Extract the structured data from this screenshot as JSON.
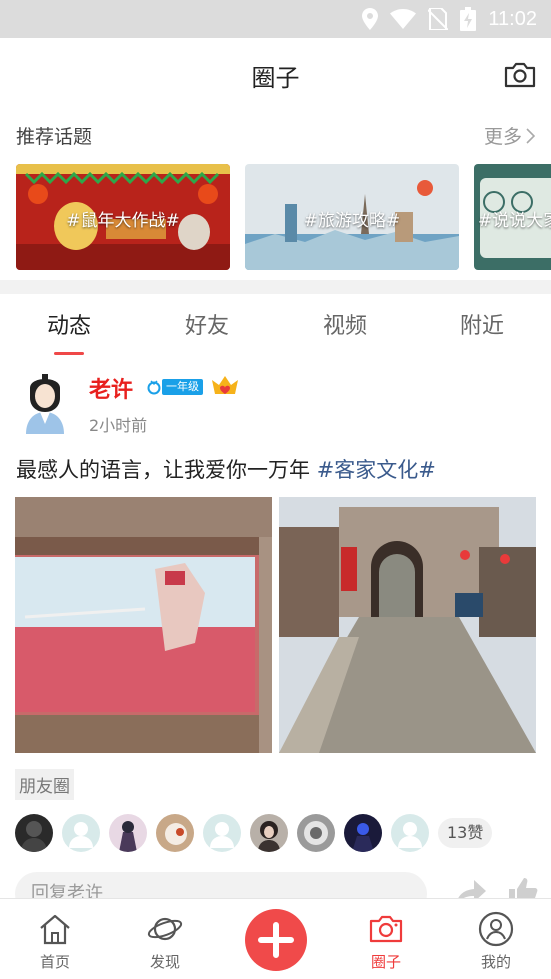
{
  "status_bar": {
    "time": "11:02"
  },
  "header": {
    "title": "圈子"
  },
  "recommend": {
    "title": "推荐话题",
    "more_label": "更多",
    "topics": [
      {
        "label": "#鼠年大作战#"
      },
      {
        "label": "#旅游攻略#"
      },
      {
        "label": "#说说大家"
      }
    ]
  },
  "tabs": [
    {
      "label": "动态"
    },
    {
      "label": "好友"
    },
    {
      "label": "视频"
    },
    {
      "label": "附近"
    }
  ],
  "post": {
    "author": "老许",
    "level": "一年级",
    "time": "2小时前",
    "text": "最感人的语言，让我爱你一万年 ",
    "hashtag": "#客家文化#",
    "source_tag": "朋友圈",
    "like_count": "13赞",
    "reply_placeholder": "回复老许"
  },
  "bottom_nav": [
    {
      "label": "首页"
    },
    {
      "label": "发现"
    },
    {
      "label": ""
    },
    {
      "label": "圈子"
    },
    {
      "label": "我的"
    }
  ],
  "colors": {
    "accent": "#ef4848",
    "author_name": "#e8201e",
    "hashtag": "#3a5a8c",
    "level_badge": "#1aa0e8"
  }
}
